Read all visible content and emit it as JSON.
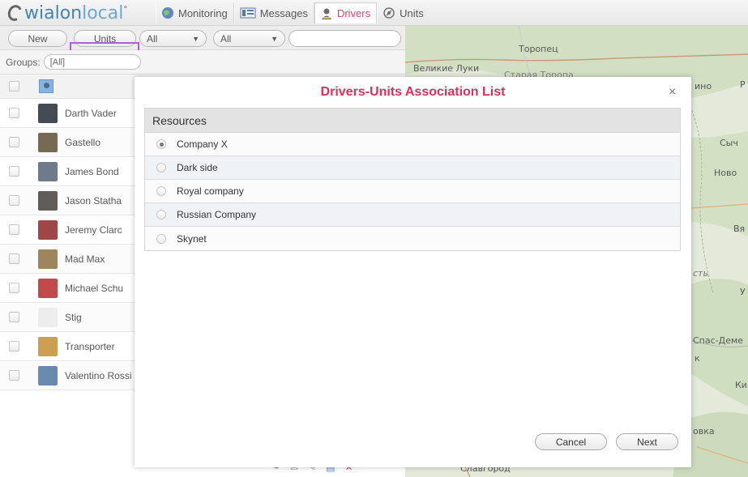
{
  "logo": {
    "text_main": "wialon",
    "text_local": "local",
    "superscript": "°"
  },
  "nav": [
    {
      "label": "Monitoring",
      "icon": "globe-icon"
    },
    {
      "label": "Messages",
      "icon": "messages-icon"
    },
    {
      "label": "Drivers",
      "icon": "driver-icon",
      "active": true
    },
    {
      "label": "Units",
      "icon": "unit-icon"
    }
  ],
  "toolbar": {
    "new_label": "New",
    "units_label": "Units",
    "filter1": "All",
    "filter2": "All",
    "search_value": ""
  },
  "groups": {
    "label": "Groups:",
    "value": "[All]"
  },
  "drivers": [
    {
      "name": "Darth Vader",
      "color": "#1c2430"
    },
    {
      "name": "Gastello",
      "color": "#5a4a30"
    },
    {
      "name": "James Bond",
      "color": "#4e5f75"
    },
    {
      "name": "Jason Statha",
      "color": "#3b3a36"
    },
    {
      "name": "Jeremy Clarc",
      "color": "#8b1e1e"
    },
    {
      "name": "Mad Max",
      "color": "#8a6a3a"
    },
    {
      "name": "Michael Schu",
      "color": "#b52222"
    },
    {
      "name": "Stig",
      "color": "#e9e9e9"
    },
    {
      "name": "Transporter",
      "color": "#c28a2a"
    },
    {
      "name": "Valentino Rossi",
      "color": "#4a6f9e"
    }
  ],
  "map_labels": {
    "toropets": "Торопец",
    "velikie_luki": "Великие Луки",
    "staraya_toropa": "Старая Торопа",
    "ino": "ино",
    "p": "Р",
    "sych": "Сыч",
    "novo": "Ново",
    "vya": "Вя",
    "st": "сть",
    "u": "У",
    "spas_deme": "Спас-Деме",
    "k": "к",
    "ki": "Ки",
    "ovka": "овка",
    "slavgorod": "Славгород"
  },
  "dialog": {
    "title": "Drivers-Units Association List",
    "close": "×",
    "table_header": "Resources",
    "resources": [
      {
        "label": "Company X",
        "selected": true
      },
      {
        "label": "Dark side",
        "selected": false
      },
      {
        "label": "Royal company",
        "selected": false
      },
      {
        "label": "Russian Company",
        "selected": false
      },
      {
        "label": "Skynet",
        "selected": false
      }
    ],
    "cancel_label": "Cancel",
    "next_label": "Next"
  },
  "colors": {
    "accent": "#d6335a",
    "highlight": "#9a3be0",
    "logo_blue": "#1a6aa6"
  }
}
